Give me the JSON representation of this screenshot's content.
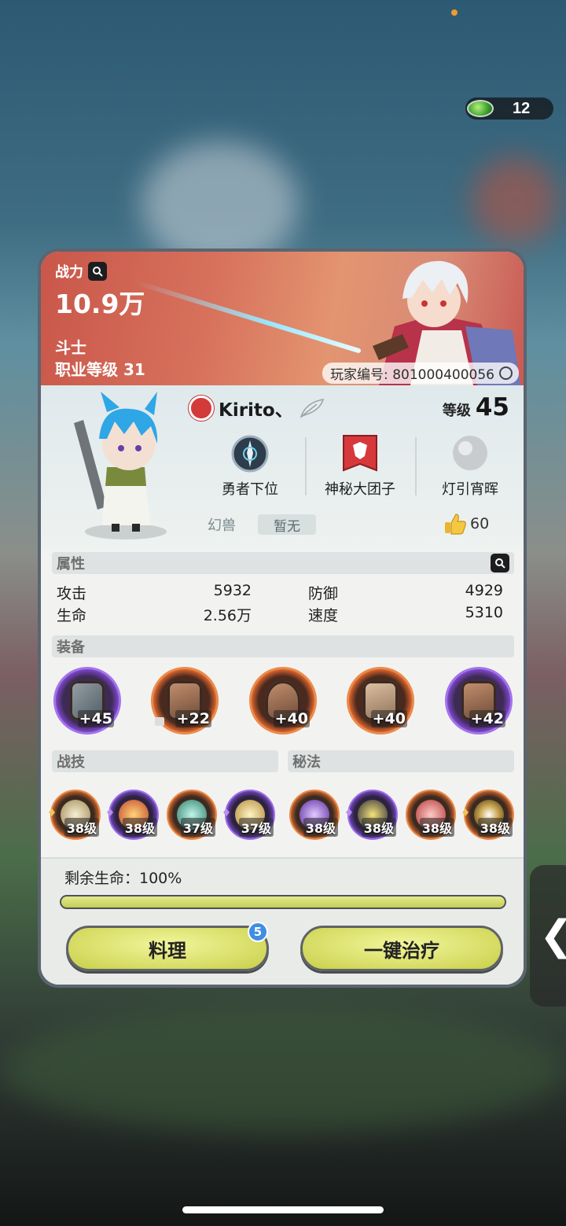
{
  "header": {
    "currency": {
      "icon": "green-gem-icon",
      "value": "12"
    }
  },
  "card": {
    "banner": {
      "power_label": "战力",
      "power_value": "10.9万",
      "job": "斗士",
      "job_level": "职业等级 31",
      "player_id": "玩家编号: 801000400056"
    },
    "profile": {
      "name": "Kirito、",
      "level_label": "等级",
      "level_value": "45",
      "titles": [
        {
          "label": "勇者下位",
          "icon": "rank-emblem-icon"
        },
        {
          "label": "神秘大团子",
          "icon": "guild-banner-icon"
        },
        {
          "label": "灯引宵晖",
          "icon": "silver-orb-icon"
        }
      ],
      "beast_label": "幻兽",
      "beast_value": "暂无",
      "likes": "60"
    },
    "attributes": {
      "section": "属性",
      "stats": [
        {
          "name": "攻击",
          "value": "5932"
        },
        {
          "name": "防御",
          "value": "4929"
        },
        {
          "name": "生命",
          "value": "2.56万"
        },
        {
          "name": "速度",
          "value": "5310"
        }
      ]
    },
    "equipment": {
      "section": "装备",
      "items": [
        {
          "plus": "+45",
          "rarity": "purple",
          "icon": "greatsword-icon"
        },
        {
          "plus": "+22",
          "rarity": "orange",
          "icon": "gauntlet-icon",
          "locked": true
        },
        {
          "plus": "+40",
          "rarity": "orange",
          "icon": "horned-helmet-icon"
        },
        {
          "plus": "+40",
          "rarity": "orange",
          "icon": "chest-armor-icon"
        },
        {
          "plus": "+42",
          "rarity": "purple",
          "icon": "boots-icon"
        }
      ]
    },
    "skills": {
      "combat_section": "战技",
      "secret_section": "秘法",
      "combat": [
        {
          "level": "38级",
          "rarity": "orange",
          "icon": "ring-slash-icon"
        },
        {
          "level": "38级",
          "rarity": "purple",
          "icon": "flame-icon"
        },
        {
          "level": "37级",
          "rarity": "orange",
          "icon": "web-icon"
        },
        {
          "level": "37级",
          "rarity": "purple",
          "icon": "blade-strike-icon"
        }
      ],
      "secret": [
        {
          "level": "38级",
          "rarity": "orange",
          "icon": "arcane-orb-icon"
        },
        {
          "level": "38级",
          "rarity": "purple",
          "icon": "shadow-icon"
        },
        {
          "level": "38级",
          "rarity": "orange",
          "icon": "crimson-orb-icon"
        },
        {
          "level": "38级",
          "rarity": "orange",
          "icon": "eye-sigil-icon"
        }
      ]
    },
    "hp": {
      "label": "剩余生命：100%",
      "fraction": 1.0
    },
    "buttons": {
      "cook": "料理",
      "cook_badge": "5",
      "heal": "一键治疗"
    }
  },
  "colors": {
    "accent_yellow": "#d5db62",
    "purple_rarity": "#a374ea",
    "orange_rarity": "#eb8a4a",
    "badge_blue": "#3f8ee4"
  }
}
